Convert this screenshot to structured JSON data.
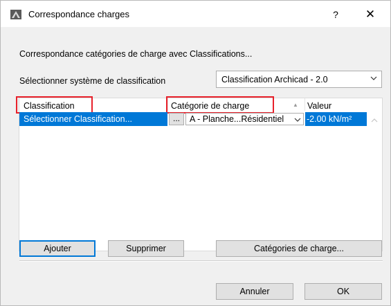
{
  "window": {
    "title": "Correspondance charges",
    "help_label": "?",
    "close_label": "✕"
  },
  "intro_text": "Correspondance catégories de charge avec Classifications...",
  "classification_system": {
    "label": "Sélectionner système de classification",
    "selected": "Classification Archicad - 2.0"
  },
  "table": {
    "columns": [
      "Classification",
      "Catégorie de charge",
      "Valeur"
    ],
    "sort_indicator": "▲",
    "rows": [
      {
        "classification": "Sélectionner Classification...",
        "ellipsis": "...",
        "category": "A - Planche...Résidentiel",
        "value": "-2.00 kN/m²"
      }
    ]
  },
  "buttons": {
    "add": "Ajouter",
    "delete": "Supprimer",
    "load_categories": "Catégories de charge...",
    "cancel": "Annuler",
    "ok": "OK"
  },
  "highlight_color": "#e8202a",
  "selection_color": "#0078d7"
}
